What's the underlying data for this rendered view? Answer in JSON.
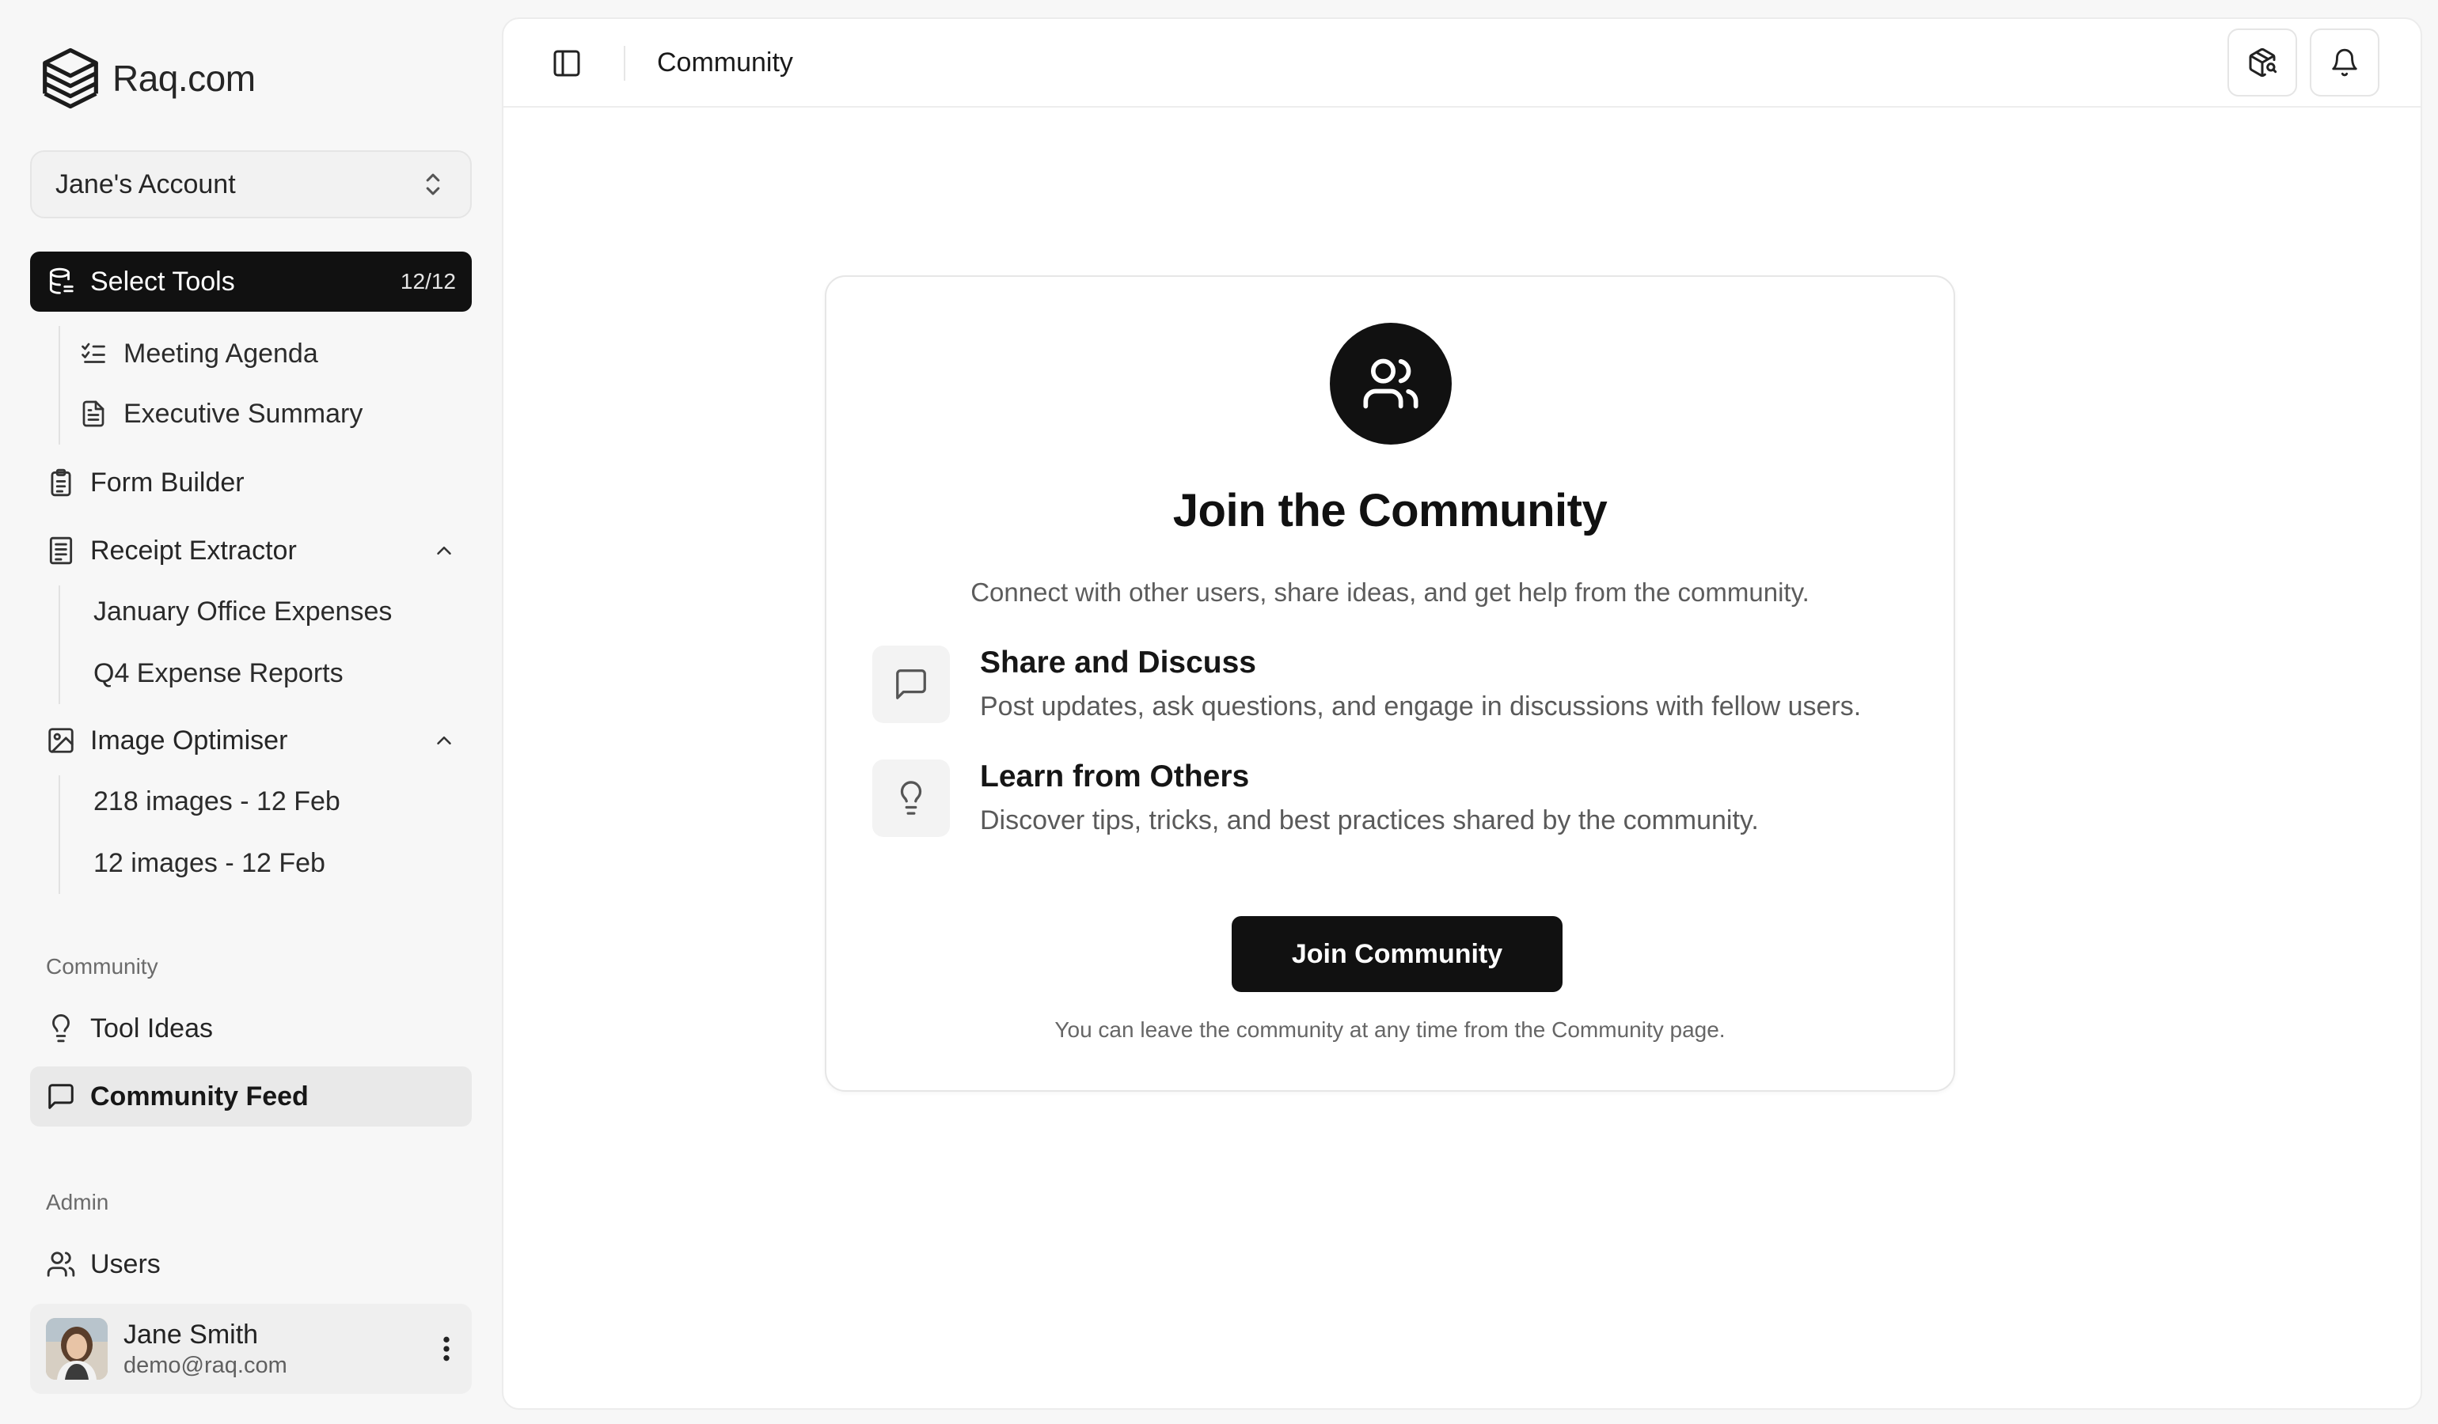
{
  "brand": {
    "name": "Raq.com"
  },
  "account": {
    "name": "Jane's Account"
  },
  "sidebar": {
    "select_tools": {
      "label": "Select Tools",
      "badge": "12/12"
    },
    "select_tools_children": [
      "Meeting Agenda",
      "Executive Summary"
    ],
    "form_builder": {
      "label": "Form Builder"
    },
    "receipt_extractor": {
      "label": "Receipt Extractor",
      "children": [
        "January Office Expenses",
        "Q4 Expense Reports"
      ]
    },
    "image_optimiser": {
      "label": "Image Optimiser",
      "children": [
        "218 images - 12 Feb",
        "12 images - 12 Feb"
      ]
    },
    "community_section": "Community",
    "tool_ideas": "Tool Ideas",
    "community_feed": "Community Feed",
    "admin_section": "Admin",
    "users": "Users"
  },
  "user": {
    "name": "Jane Smith",
    "email": "demo@raq.com"
  },
  "topbar": {
    "title": "Community"
  },
  "card": {
    "title": "Join the Community",
    "subtitle": "Connect with other users, share ideas, and get help from the community.",
    "features": [
      {
        "title": "Share and Discuss",
        "desc": "Post updates, ask questions, and engage in discussions with fellow users.",
        "icon": "message-square-icon"
      },
      {
        "title": "Learn from Others",
        "desc": "Discover tips, tricks, and best practices shared by the community.",
        "icon": "lightbulb-icon"
      }
    ],
    "button": "Join Community",
    "footnote": "You can leave the community at any time from the Community page."
  },
  "colors": {
    "accent": "#111111",
    "selected_bg": "#e9e9e9",
    "page_bg": "#f7f7f7"
  }
}
